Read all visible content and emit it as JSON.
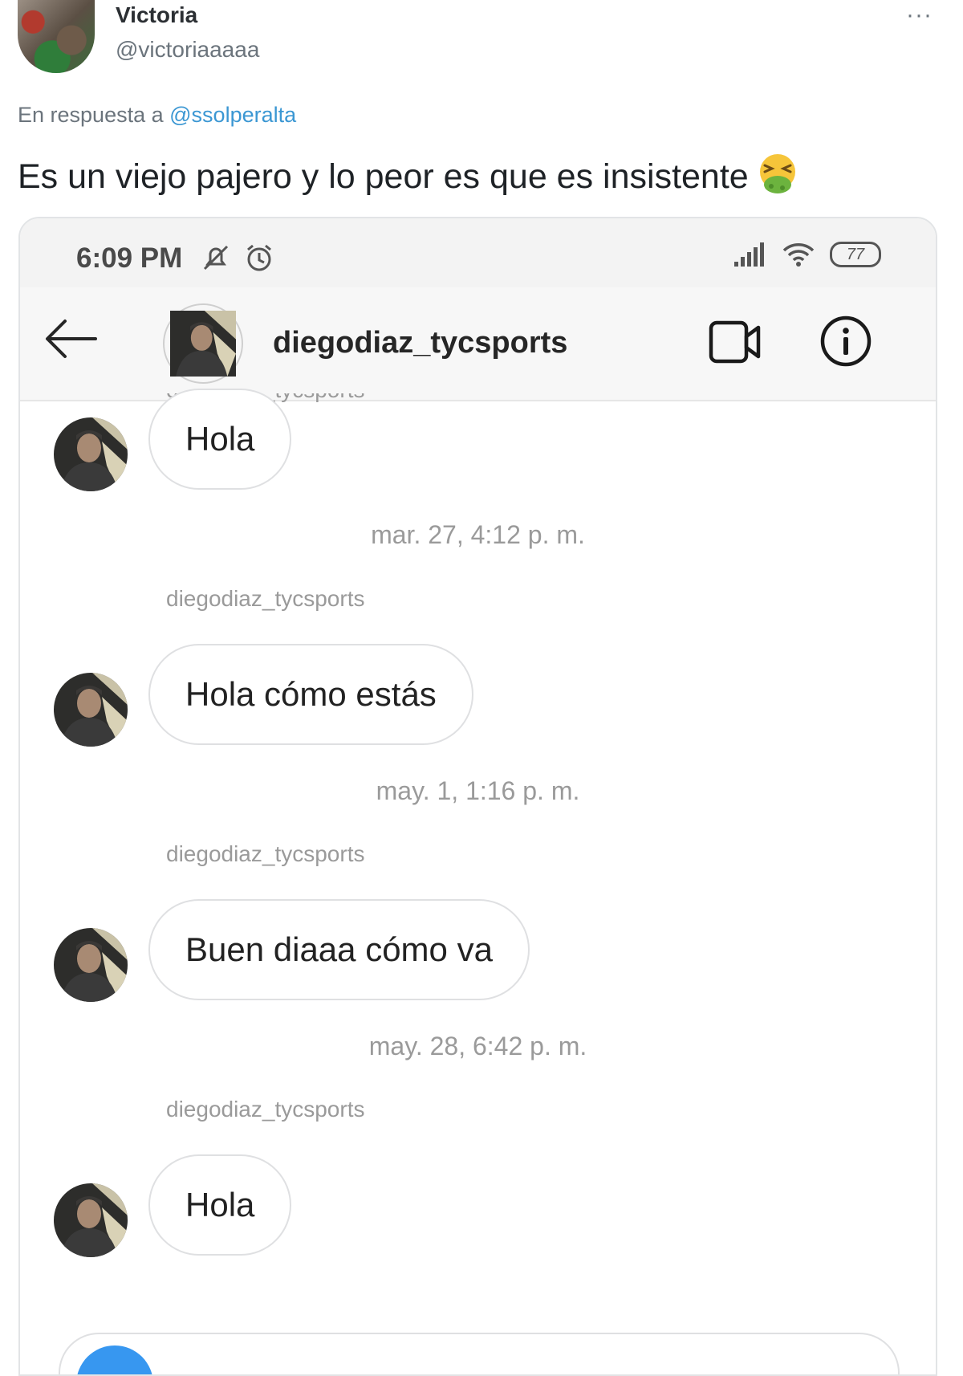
{
  "tweet": {
    "author_name": "Victoria",
    "author_handle": "@victoriaaaaa",
    "more": "···",
    "reply_prefix": "En respuesta a",
    "reply_mention": "@ssolperalta",
    "text": "Es un viejo pajero y lo peor es que es insistente",
    "emoji": "face-vomiting-icon"
  },
  "phone": {
    "status_time": "6:09 PM",
    "battery": "77"
  },
  "chat": {
    "username": "diegodiaz_tycsports",
    "cutoff_label": "diegodiaz_tycsports",
    "messages": [
      {
        "sender": "",
        "text": "Hola"
      },
      {
        "timestamp": "mar. 27, 4:12 p. m.",
        "sender": "diegodiaz_tycsports",
        "text": "Hola cómo estás"
      },
      {
        "timestamp": "may. 1, 1:16 p. m.",
        "sender": "diegodiaz_tycsports",
        "text": "Buen diaaa cómo va"
      },
      {
        "timestamp": "may. 28, 6:42 p. m.",
        "sender": "diegodiaz_tycsports",
        "text": "Hola"
      }
    ]
  },
  "colors": {
    "mention": "#3b97d3",
    "camera_button": "#3797f0"
  }
}
